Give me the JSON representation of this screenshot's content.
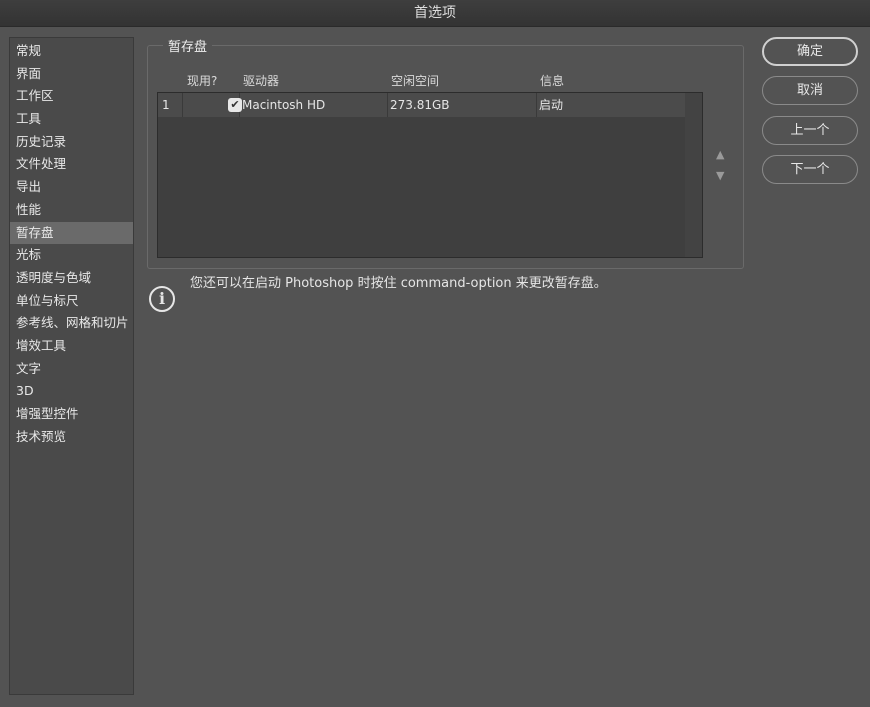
{
  "window": {
    "title": "首选项"
  },
  "sidebar": {
    "items": [
      {
        "label": "常规"
      },
      {
        "label": "界面"
      },
      {
        "label": "工作区"
      },
      {
        "label": "工具"
      },
      {
        "label": "历史记录"
      },
      {
        "label": "文件处理"
      },
      {
        "label": "导出"
      },
      {
        "label": "性能"
      },
      {
        "label": "暂存盘",
        "selected": true
      },
      {
        "label": "光标"
      },
      {
        "label": "透明度与色域"
      },
      {
        "label": "单位与标尺"
      },
      {
        "label": "参考线、网格和切片"
      },
      {
        "label": "增效工具"
      },
      {
        "label": "文字"
      },
      {
        "label": "3D"
      },
      {
        "label": "增强型控件"
      },
      {
        "label": "技术预览"
      }
    ]
  },
  "scratch": {
    "title": "暂存盘",
    "columns": {
      "active": "现用?",
      "drive": "驱动器",
      "free": "空闲空间",
      "info": "信息"
    },
    "rows": [
      {
        "index": "1",
        "active": true,
        "drive": "Macintosh HD",
        "free": "273.81GB",
        "info": "启动"
      }
    ],
    "note": "您还可以在启动 Photoshop 时按住 command-option 来更改暂存盘。"
  },
  "buttons": {
    "ok": "确定",
    "cancel": "取消",
    "prev": "上一个",
    "next": "下一个"
  }
}
